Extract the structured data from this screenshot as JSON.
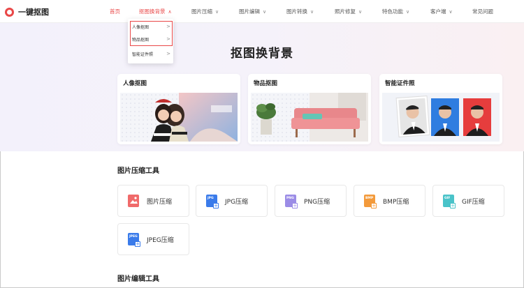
{
  "brand": {
    "name": "一键抠图"
  },
  "nav": [
    {
      "label": "首页",
      "active": true,
      "chevron": false
    },
    {
      "label": "抠图换背景",
      "active": true,
      "chevron": true,
      "chevron_glyph": "∧"
    },
    {
      "label": "图片压缩",
      "active": false,
      "chevron": true,
      "chevron_glyph": "∨"
    },
    {
      "label": "图片编辑",
      "active": false,
      "chevron": true,
      "chevron_glyph": "∨"
    },
    {
      "label": "图片转换",
      "active": false,
      "chevron": true,
      "chevron_glyph": "∨"
    },
    {
      "label": "照片修复",
      "active": false,
      "chevron": true,
      "chevron_glyph": "∨"
    },
    {
      "label": "特色功能",
      "active": false,
      "chevron": true,
      "chevron_glyph": "∨"
    },
    {
      "label": "客户端",
      "active": false,
      "chevron": true,
      "chevron_glyph": "∨"
    },
    {
      "label": "常见问题",
      "active": false,
      "chevron": false
    }
  ],
  "dropdown": {
    "items": [
      {
        "label": "人像抠图",
        "arrow": ">"
      },
      {
        "label": "物品抠图",
        "arrow": ">"
      },
      {
        "label": "智能证件照",
        "arrow": ">"
      }
    ]
  },
  "hero": {
    "title": "抠图换背景",
    "cards": [
      {
        "title": "人像抠图"
      },
      {
        "title": "物品抠图"
      },
      {
        "title": "智能证件照"
      }
    ]
  },
  "compress": {
    "title": "图片压缩工具",
    "tools": [
      {
        "label": "图片压缩",
        "icon": "image-icon",
        "tag": "",
        "color": "#f06a6a"
      },
      {
        "label": "JPG压缩",
        "icon": "jpg-file-icon",
        "tag": "JPG",
        "color": "#3a7bea"
      },
      {
        "label": "PNG压缩",
        "icon": "png-file-icon",
        "tag": "PNG",
        "color": "#9b8ce6"
      },
      {
        "label": "BMP压缩",
        "icon": "bmp-file-icon",
        "tag": "BMP",
        "color": "#f39a3b"
      },
      {
        "label": "GIF压缩",
        "icon": "gif-file-icon",
        "tag": "GIF",
        "color": "#4ac3c9"
      },
      {
        "label": "JPEG压缩",
        "icon": "jpeg-file-icon",
        "tag": "JPEG",
        "color": "#3a7bea"
      }
    ]
  },
  "edit": {
    "title": "图片编辑工具"
  },
  "colors": {
    "accent": "#e94747"
  }
}
